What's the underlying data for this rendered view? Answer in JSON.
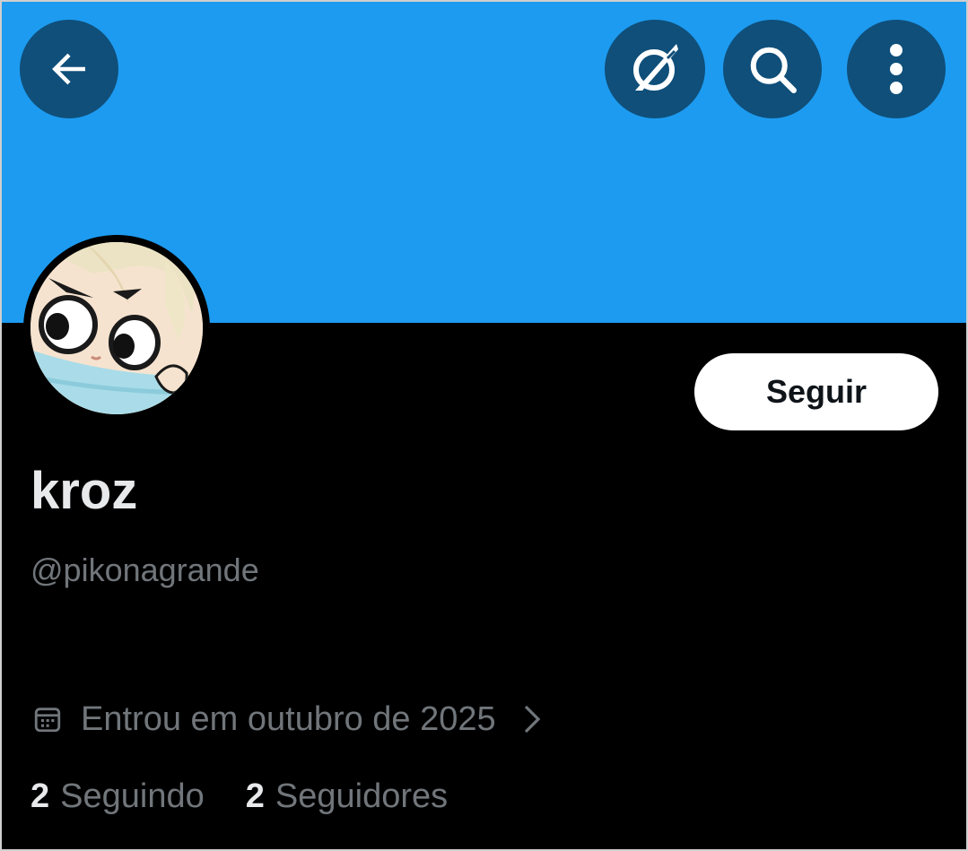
{
  "colors": {
    "banner": "#1d9bf0",
    "header_button_bg": "#0f4f7a",
    "background": "#000000",
    "primary_text": "#e7e9ea",
    "secondary_text": "#71767b",
    "follow_button_bg": "#ffffff"
  },
  "header": {
    "icons": [
      "arrow-left-icon",
      "grok-icon",
      "search-icon",
      "more-vertical-icon"
    ]
  },
  "profile": {
    "follow_label": "Seguir",
    "display_name": "kroz",
    "handle": "@pikonagrande",
    "joined": "Entrou em outubro de 2025"
  },
  "stats": {
    "following": {
      "count": "2",
      "label": "Seguindo"
    },
    "followers": {
      "count": "2",
      "label": "Seguidores"
    }
  }
}
